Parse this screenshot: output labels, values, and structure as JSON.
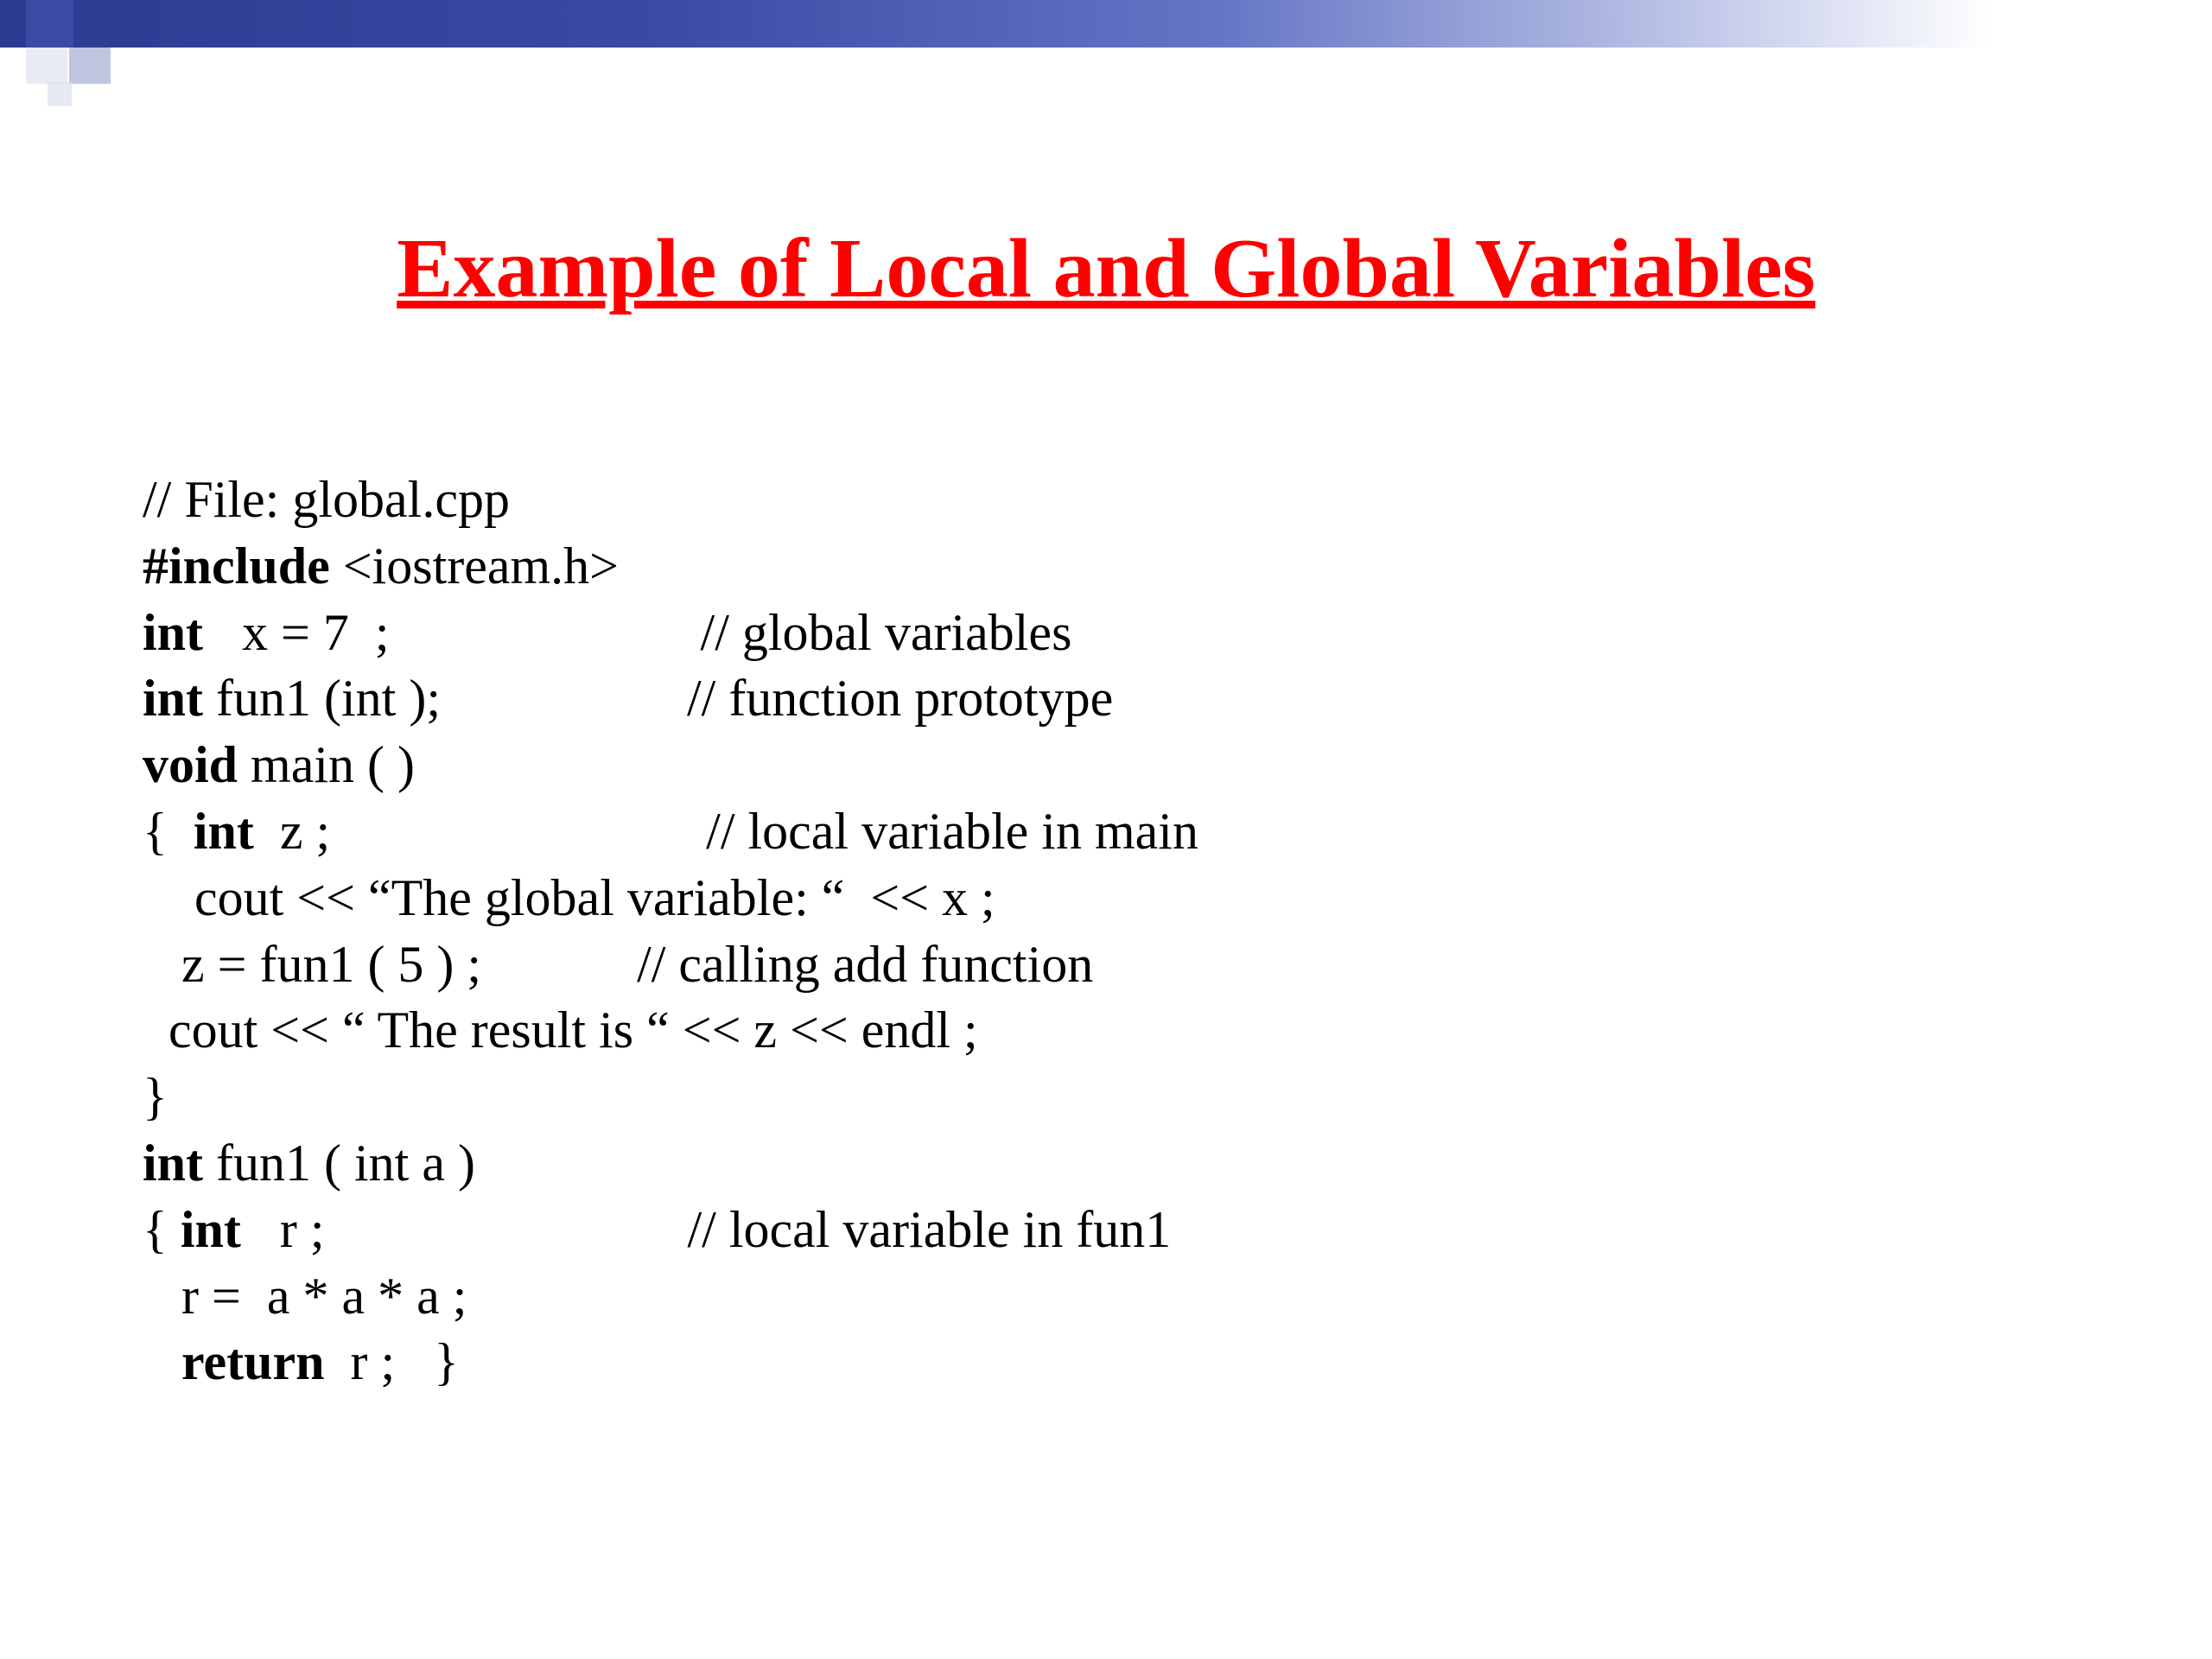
{
  "slide": {
    "title": "Example of Local and Global Variables",
    "colors": {
      "title": "#ff0000",
      "bar_gradient_start": "#2c3a8f",
      "bar_gradient_end": "#ffffff"
    },
    "code": {
      "line1": "// File: global.cpp",
      "line2_bold": "#include",
      "line2_rest": " <iostream.h>",
      "line3_bold": "int",
      "line3_rest": "   x = 7  ;                        // global variables",
      "line4_bold": "int",
      "line4_rest": " fun1 (int );                   // function prototype",
      "line5_bold": "void",
      "line5_rest": " main ( )",
      "line6_open": "{  ",
      "line6_bold": "int",
      "line6_rest": "  z ;                             // local variable in main",
      "line7": "    cout << “The global variable: “  << x ;",
      "line8": "   z = fun1 ( 5 ) ;            // calling add function",
      "line9": "  cout << “ The result is “ << z << endl ;",
      "line10": "}",
      "line11_bold": "int",
      "line11_rest": " fun1 ( int a )",
      "line12_open": "{ ",
      "line12_bold": "int",
      "line12_rest": "   r ;                            // local variable in fun1",
      "line13": "   r =  a * a * a ;",
      "line14_pre": "   ",
      "line14_bold": "return",
      "line14_rest": "  r ;   }"
    }
  }
}
